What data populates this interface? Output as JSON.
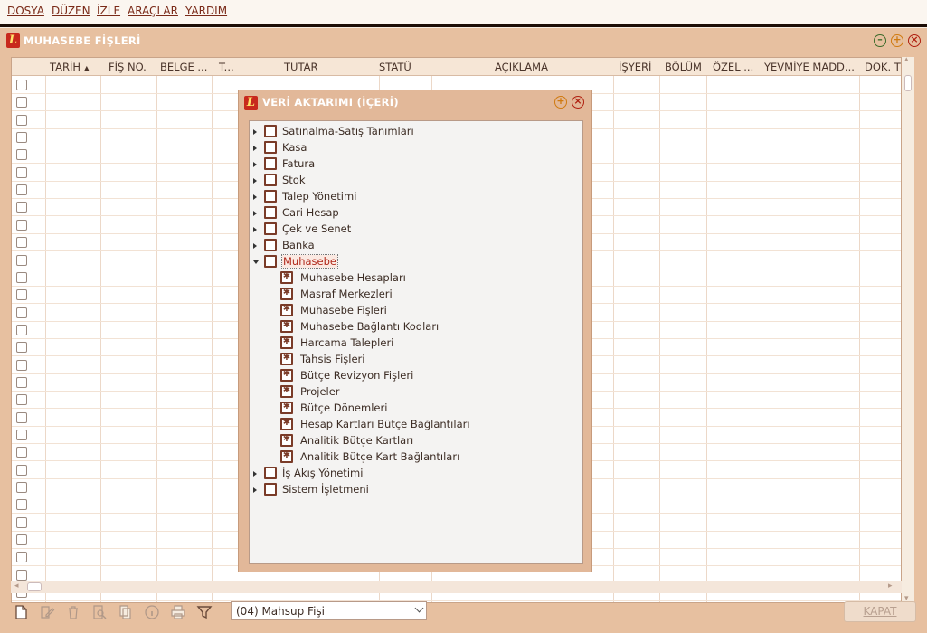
{
  "menubar": {
    "items": [
      "DOSYA",
      "DÜZEN",
      "İZLE",
      "ARAÇLAR",
      "YARDIM"
    ]
  },
  "window": {
    "title": "MUHASEBE FİŞLERİ"
  },
  "grid": {
    "columns": [
      "TARİH",
      "FİŞ NO.",
      "BELGE ...",
      "T...",
      "TUTAR",
      "STATÜ",
      "AÇIKLAMA",
      "İŞYERİ",
      "BÖLÜM",
      "ÖZEL ...",
      "YEVMİYE MADD...",
      "DOK. T"
    ],
    "sort_indicator": "▲"
  },
  "dialog": {
    "title": "VERİ AKTARIMI (İÇERİ)",
    "tree": [
      {
        "label": "Satınalma-Satış Tanımları",
        "level": 0,
        "state": "collapsed",
        "checked": false
      },
      {
        "label": "Kasa",
        "level": 0,
        "state": "collapsed",
        "checked": false
      },
      {
        "label": "Fatura",
        "level": 0,
        "state": "collapsed",
        "checked": false
      },
      {
        "label": "Stok",
        "level": 0,
        "state": "collapsed",
        "checked": false
      },
      {
        "label": "Talep Yönetimi",
        "level": 0,
        "state": "collapsed",
        "checked": false
      },
      {
        "label": "Cari Hesap",
        "level": 0,
        "state": "collapsed",
        "checked": false
      },
      {
        "label": "Çek ve Senet",
        "level": 0,
        "state": "collapsed",
        "checked": false
      },
      {
        "label": "Banka",
        "level": 0,
        "state": "collapsed",
        "checked": false
      },
      {
        "label": "Muhasebe",
        "level": 0,
        "state": "expanded",
        "checked": false,
        "selected": true
      },
      {
        "label": "Muhasebe Hesapları",
        "level": 1,
        "checked": true
      },
      {
        "label": "Masraf Merkezleri",
        "level": 1,
        "checked": true
      },
      {
        "label": "Muhasebe Fişleri",
        "level": 1,
        "checked": true
      },
      {
        "label": "Muhasebe Bağlantı Kodları",
        "level": 1,
        "checked": true
      },
      {
        "label": "Harcama Talepleri",
        "level": 1,
        "checked": true
      },
      {
        "label": "Tahsis Fişleri",
        "level": 1,
        "checked": true
      },
      {
        "label": "Bütçe Revizyon Fişleri",
        "level": 1,
        "checked": true
      },
      {
        "label": "Projeler",
        "level": 1,
        "checked": true
      },
      {
        "label": "Bütçe Dönemleri",
        "level": 1,
        "checked": true
      },
      {
        "label": "Hesap Kartları Bütçe Bağlantıları",
        "level": 1,
        "checked": true
      },
      {
        "label": "Analitik Bütçe Kartları",
        "level": 1,
        "checked": true
      },
      {
        "label": "Analitik Bütçe Kart Bağlantıları",
        "level": 1,
        "checked": true
      },
      {
        "label": "İş Akış Yönetimi",
        "level": 0,
        "state": "collapsed",
        "checked": false
      },
      {
        "label": "Sistem İşletmeni",
        "level": 0,
        "state": "collapsed",
        "checked": false
      }
    ]
  },
  "footer": {
    "doc_type_value": "(04) Mahsup Fişi",
    "close_label": "KAPAT",
    "toolbar_icons": [
      "new-document-icon",
      "edit-icon",
      "delete-icon",
      "preview-icon",
      "copy-icon",
      "info-icon",
      "print-icon",
      "filter-icon"
    ]
  },
  "colors": {
    "accent": "#c8281c",
    "window_bg": "#e7c0a0",
    "dark_text": "#7a2a18"
  }
}
